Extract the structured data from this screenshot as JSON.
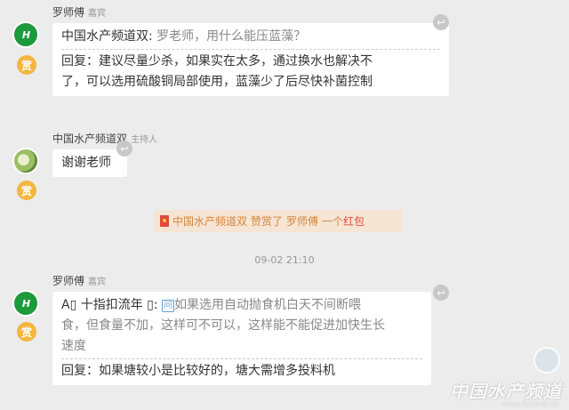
{
  "messages": [
    {
      "sender": "罗师傅",
      "role": "嘉宾",
      "asker": "中国水产频道双:",
      "question": "罗老师，用什么能压蓝藻？",
      "reply_line1": "回复：建议尽量少杀，如果实在太多，通过换水也解决不",
      "reply_line2": "了，可以选用硫酸铜局部使用，蓝藻少了后尽快补菌控制",
      "avatar_text": "H",
      "badge": "赏",
      "recall_icon": "↩"
    },
    {
      "sender": "中国水产频道双",
      "role": "主持人",
      "text": "谢谢老师",
      "badge": "赏",
      "recall_icon": "↩"
    },
    {
      "sender": "罗师傅",
      "role": "嘉宾",
      "asker": "A▯ 十指扣流年 ▯:",
      "q_icon": "问",
      "question_line1": "如果选用自动抛食机白天不间断喂",
      "question_line2": "食，但食量不加，这样可不可以，这样能不能促进加快生长",
      "question_line3": "速度",
      "reply": "回复：如果塘较小是比较好的，塘大需增多投料机",
      "avatar_text": "H",
      "badge": "赏",
      "recall_icon": "↩"
    }
  ],
  "reward_banner": {
    "from": "中国水产频道双",
    "verb": "赞赏了",
    "to": "罗师傅",
    "count": "一个",
    "item": "红包"
  },
  "timestamp": "09-02 21:10",
  "watermark": {
    "text": "中国水产频道",
    "url": "www.fishfirst.cn"
  },
  "colors": {
    "background": "#ececec",
    "bubble": "#ffffff",
    "badge": "#f3b63f",
    "banner_bg": "#f6e5d4",
    "banner_text": "#d4863b",
    "red_packet": "#e14a3c"
  }
}
